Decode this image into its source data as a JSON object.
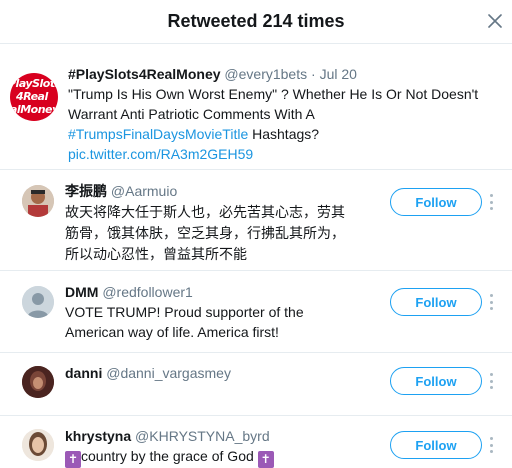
{
  "header": {
    "title": "Retweeted 214 times",
    "close_icon": "close-icon"
  },
  "tweet": {
    "avatar_logo_lines": [
      "PlaySlots",
      "4Real",
      "alMoney"
    ],
    "name": "#PlaySlots4RealMoney",
    "handle": "@every1bets",
    "separator": "·",
    "date": "Jul 20",
    "text": "\"Trump Is His Own Worst Enemy\" ? Whether He Is Or Not Doesn't Warrant Anti Patriotic Comments With A",
    "hashtag": "#TrumpsFinalDaysMovieTitle",
    "text_after": "Hashtags?",
    "link": "pic.twitter.com/RA3m2GEH59"
  },
  "users": [
    {
      "name": "李振鹏",
      "handle": "@Aarmuio",
      "bio": "故天将降大任于斯人也，必先苦其心志，劳其筋骨，饿其体肤，空乏其身，行拂乱其所为，所以动心忍性，曾益其所不能",
      "follow_label": "Follow"
    },
    {
      "name": "DMM",
      "handle": "@redfollower1",
      "bio": "VOTE TRUMP! Proud supporter of the American way of life. America first!",
      "follow_label": "Follow"
    },
    {
      "name": "danni",
      "handle": "@danni_vargasmey",
      "bio": "",
      "follow_label": "Follow"
    },
    {
      "name": "khrystyna",
      "handle": "@KHRYSTYNA_byrd",
      "bio": "country by the grace of God",
      "bio_icon": "latin-cross-icon",
      "follow_label": "Follow"
    }
  ],
  "colors": {
    "accent": "#1da1f2",
    "link": "#1b95e0",
    "muted": "#657786",
    "divider": "#e6ecf0"
  }
}
